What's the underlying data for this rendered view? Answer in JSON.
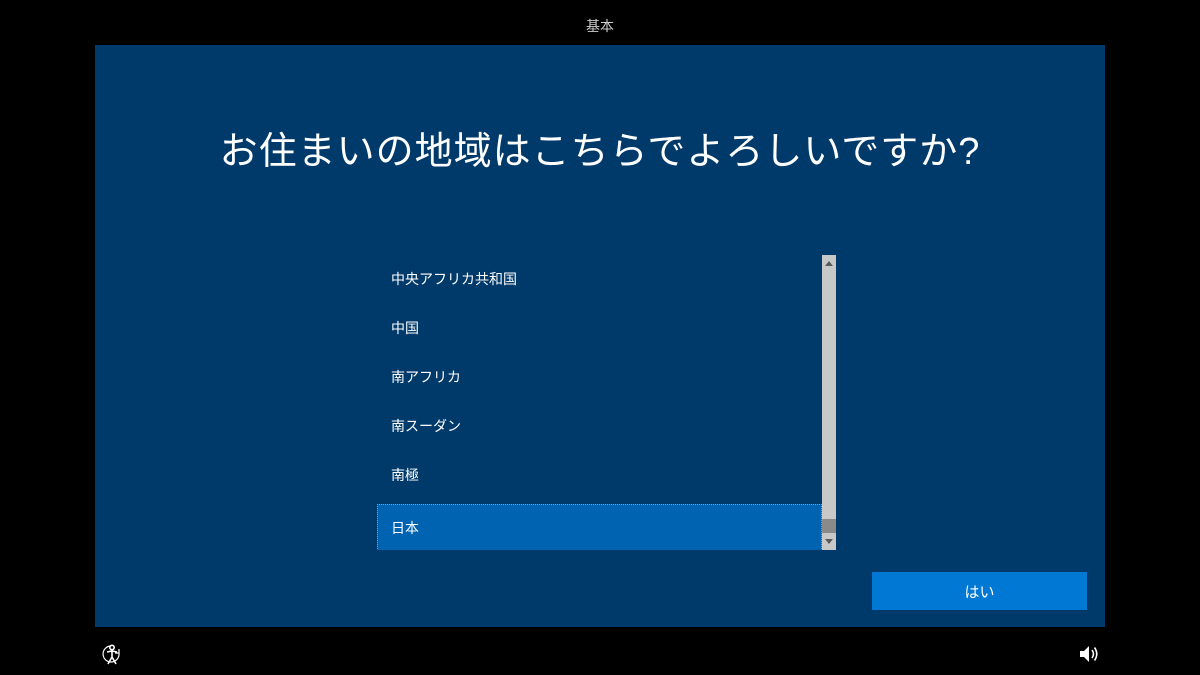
{
  "tabs": {
    "basic": "基本"
  },
  "page": {
    "title": "お住まいの地域はこちらでよろしいですか?"
  },
  "regions": {
    "items": [
      {
        "label": "中央アフリカ共和国",
        "selected": false
      },
      {
        "label": "中国",
        "selected": false
      },
      {
        "label": "南アフリカ",
        "selected": false
      },
      {
        "label": "南スーダン",
        "selected": false
      },
      {
        "label": "南極",
        "selected": false
      },
      {
        "label": "日本",
        "selected": true
      }
    ]
  },
  "buttons": {
    "yes": "はい"
  },
  "icons": {
    "accessibility": "accessibility-icon",
    "volume": "volume-icon"
  },
  "colors": {
    "panel_bg": "#003a6a",
    "selected_bg": "#0063b1",
    "button_bg": "#0078d4",
    "page_bg": "#000000"
  }
}
